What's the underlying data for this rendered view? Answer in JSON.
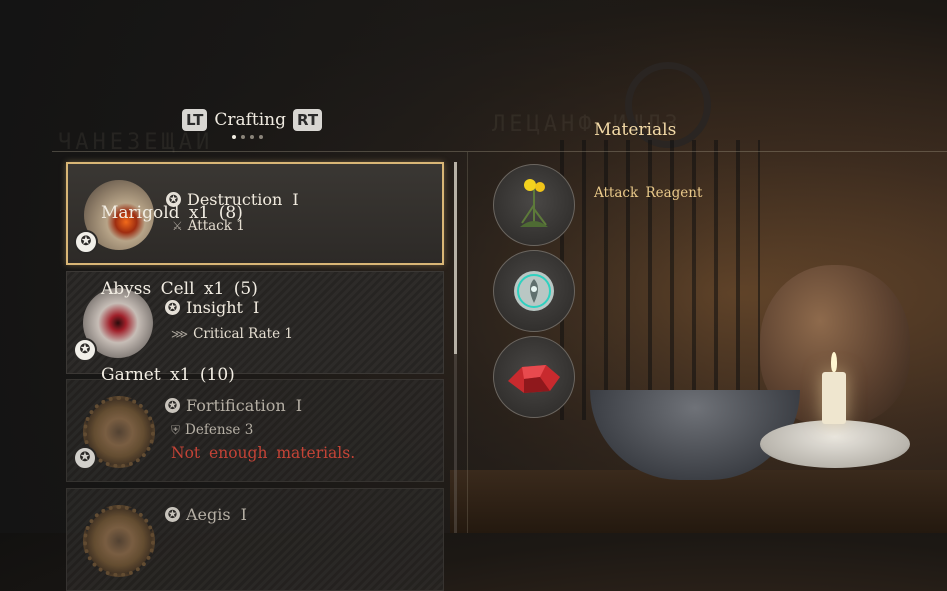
{
  "header": {
    "lt_key": "LT",
    "rt_key": "RT",
    "tab_title": "Crafting",
    "page_count": 4,
    "active_page": 1
  },
  "materials_heading": "Materials",
  "recipes": [
    {
      "name": "Destruction  I",
      "stat": "Attack 1",
      "stat_icon": "sword-icon",
      "selected": true,
      "warning": ""
    },
    {
      "name": "Insight  I",
      "stat": "Critical  Rate 1",
      "stat_icon": "claw-icon",
      "selected": false,
      "warning": ""
    },
    {
      "name": "Fortification  I",
      "stat": "Defense 3",
      "stat_icon": "shield-icon",
      "selected": false,
      "warning": "Not  enough  materials."
    },
    {
      "name": "Aegis  I",
      "stat": "",
      "stat_icon": "shield-icon",
      "selected": false,
      "warning": ""
    }
  ],
  "materials": [
    {
      "category": "Attack  Reagent",
      "name": "Marigold  x1  (8)",
      "icon": "marigold-flower-icon"
    },
    {
      "category": "",
      "name": "Abyss  Cell  x1  (5)",
      "icon": "abyss-cell-icon"
    },
    {
      "category": "",
      "name": "Garnet  x1  (10)",
      "icon": "garnet-gem-icon"
    }
  ],
  "colors": {
    "selected_border": "#d9b676",
    "warning": "#e04b3c",
    "category": "#e9c98a"
  }
}
